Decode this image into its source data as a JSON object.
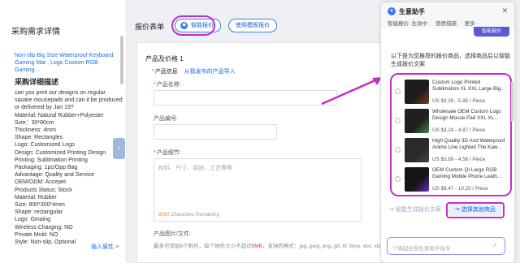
{
  "left_panel": {
    "title": "采购需求详情",
    "product_link": "Non-slip Big Size Waterproof Keyboard Gaming Mat , Logo Custom RGB Gaming...",
    "subtitle": "采购详细描述",
    "description_lines": [
      "can you print our designs on regular",
      "square mousepads and can it be produced",
      "or delivered by Jan 19?",
      "Material: Natural Rubber+Polyester",
      "Size：30*80cm",
      "Thickness: 4mm",
      "Shape: Rectangles",
      "Logo: Customized Logo",
      "Design: Customized Printing Design",
      "Printing: Sublimation Printing",
      "Packaging: 1pc/Opp Bag",
      "Advantage: Quality and Service",
      "OEM/ODM: Accepet",
      "Products Status: Stock",
      "Material: Rubber",
      "Size: 800*300*4mm",
      "Shape: rectangular",
      "Logo: Gmaing",
      "Wireless Charging: NO",
      "Private Mold: NO",
      "Style: Non-slip, Optional"
    ],
    "insert_link": "插入属性 >",
    "collapse_icon": "‹"
  },
  "form": {
    "header": "报价表单",
    "ai_quote_button": "智能报价",
    "template_quote_button": "使用模板报价",
    "card_title": "产品及价格 1",
    "product_info_label": "产品信息",
    "import_link": "从我发布的产品导入",
    "name_label": "产品名称:",
    "code_label": "产品编号:",
    "detail_label": "产品细节:",
    "detail_placeholder": "材料、尺寸、用途、工艺等等",
    "char_count": "8000",
    "char_remaining": "Characters Remaining",
    "images_label": "产品图片/文件:",
    "images_hint_prefix": "最多可添加6个附件，每个附件大小不超过",
    "images_hint_size": "5MB",
    "images_hint_suffix": "，支持的格式：jpg, jpeg, png, gif, tif, bmp, doc, xls, txt, pdf, zip, rar, xlsx"
  },
  "assistant": {
    "title": "生意助手",
    "meta": [
      "智能报价: 生效中",
      "使用措施",
      "更多"
    ],
    "close_icon": "✕",
    "prev_button": "智能报价",
    "intro": "以下是为您推荐的报价商品，选择商品后以智能生成报价文案",
    "products": [
      {
        "name": "Custom Logo Printed Sublimation XL XXL Large Big...",
        "price": "US $3.28 - 5.95 / Piece",
        "thumb_color": "#1d1d1d",
        "accent": "#7a3c1e"
      },
      {
        "name": "Wholesale OEM Custom Logo Design Mouse Pad XXL XL...",
        "price": "US $3.24 - 4.87 / Piece",
        "thumb_color": "#202020",
        "accent": "#3a8a3a"
      },
      {
        "name": "High Quality 3D And Waterproof Anime Line Lighted The Kaw...",
        "price": "US $3.99 - 4.56 / Piece",
        "thumb_color": "#2a2a2a",
        "accent": "#444444"
      },
      {
        "name": "OEM Custom QI Large RGB Gaming Mobile Phone Leath...",
        "price": "US $9.47 - 10.25 / Piece",
        "thumb_color": "#151515",
        "accent": "#6a2fbf"
      }
    ],
    "gen_button": "智能生成报价文案",
    "other_button": "选择其他商品",
    "input_placeholder": "\"/\"唤起全部生意助手指令",
    "send_icon": "↗"
  }
}
